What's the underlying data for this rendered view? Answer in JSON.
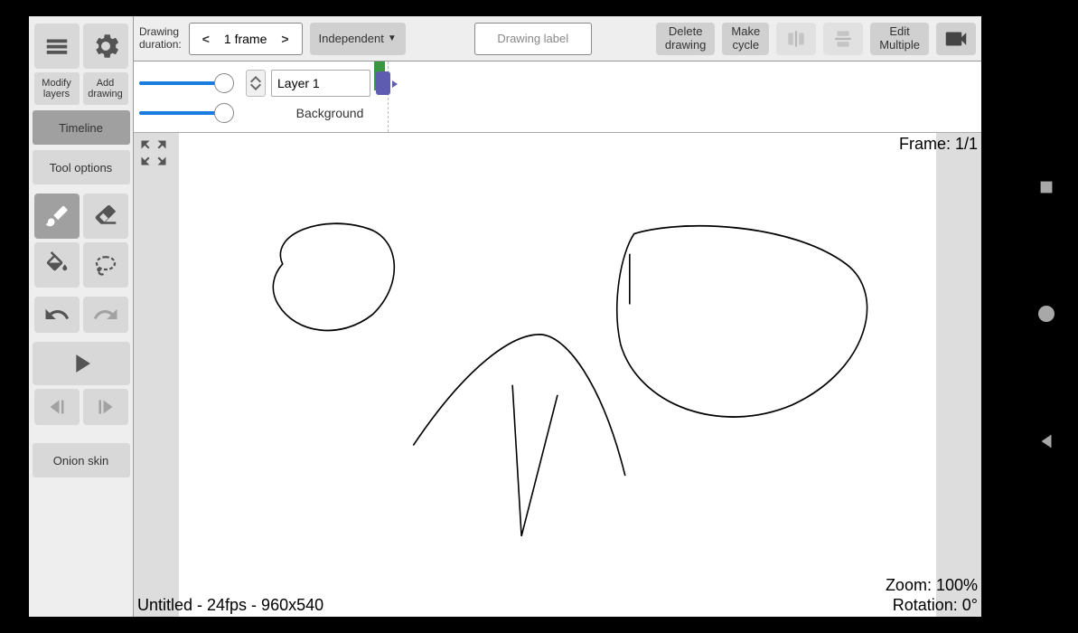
{
  "sidebar": {
    "modify_layers": "Modify\nlayers",
    "add_drawing": "Add\ndrawing",
    "timeline": "Timeline",
    "tool_options": "Tool options",
    "onion_skin": "Onion skin"
  },
  "topbar": {
    "duration_label": "Drawing\nduration:",
    "duration_value": "1 frame",
    "independent": "Independent",
    "drawing_label_placeholder": "Drawing label",
    "delete_drawing": "Delete\ndrawing",
    "make_cycle": "Make\ncycle",
    "edit_multiple": "Edit\nMultiple"
  },
  "timeline": {
    "layer1_name": "Layer 1",
    "background_label": "Background"
  },
  "canvas": {
    "frame_counter": "Frame: 1/1",
    "zoom": "Zoom: 100%",
    "rotation": "Rotation: 0°",
    "project_info": "Untitled - 24fps - 960x540"
  },
  "icons": {
    "menu": "menu-icon",
    "settings": "gear-icon",
    "brush": "brush-icon",
    "eraser": "eraser-icon",
    "fill": "fill-icon",
    "lasso": "lasso-icon",
    "undo": "undo-icon",
    "redo": "redo-icon",
    "play": "play-icon",
    "prev_key": "prev-key-icon",
    "next_key": "next-key-icon",
    "flip_h": "flip-h-icon",
    "flip_v": "flip-v-icon",
    "camera": "camera-icon"
  }
}
